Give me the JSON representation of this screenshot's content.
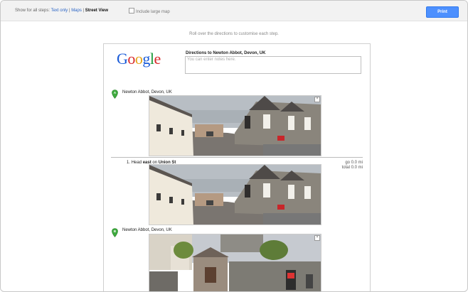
{
  "toolbar": {
    "show_for_label": "Show for all steps:",
    "options": [
      "Text only",
      "Maps",
      "Street View"
    ],
    "separator": "|",
    "include_large_map_label": "Include large map",
    "include_large_map_checked": false,
    "print_label": "Print"
  },
  "hint": "Roll over the directions to customise each step.",
  "header": {
    "logo_letters": [
      "G",
      "o",
      "o",
      "g",
      "l",
      "e"
    ],
    "title": "Directions to Newton Abbot, Devon, UK",
    "notes_placeholder": "You can enter notes here."
  },
  "start": {
    "marker": "A",
    "label": "Newton Abbot, Devon, UK"
  },
  "steps": [
    {
      "number": "1.",
      "prefix": "Head",
      "direction": "east",
      "on": "on",
      "road": "Union St",
      "go": "go 0.0 mi",
      "total": "total 0.0 mi"
    }
  ],
  "end": {
    "marker": "B",
    "label": "Newton Abbot, Devon, UK"
  },
  "colors": {
    "accent": "#4d90fe",
    "link": "#2a64c5",
    "marker": "#3fab3f"
  },
  "close_glyph": "×"
}
